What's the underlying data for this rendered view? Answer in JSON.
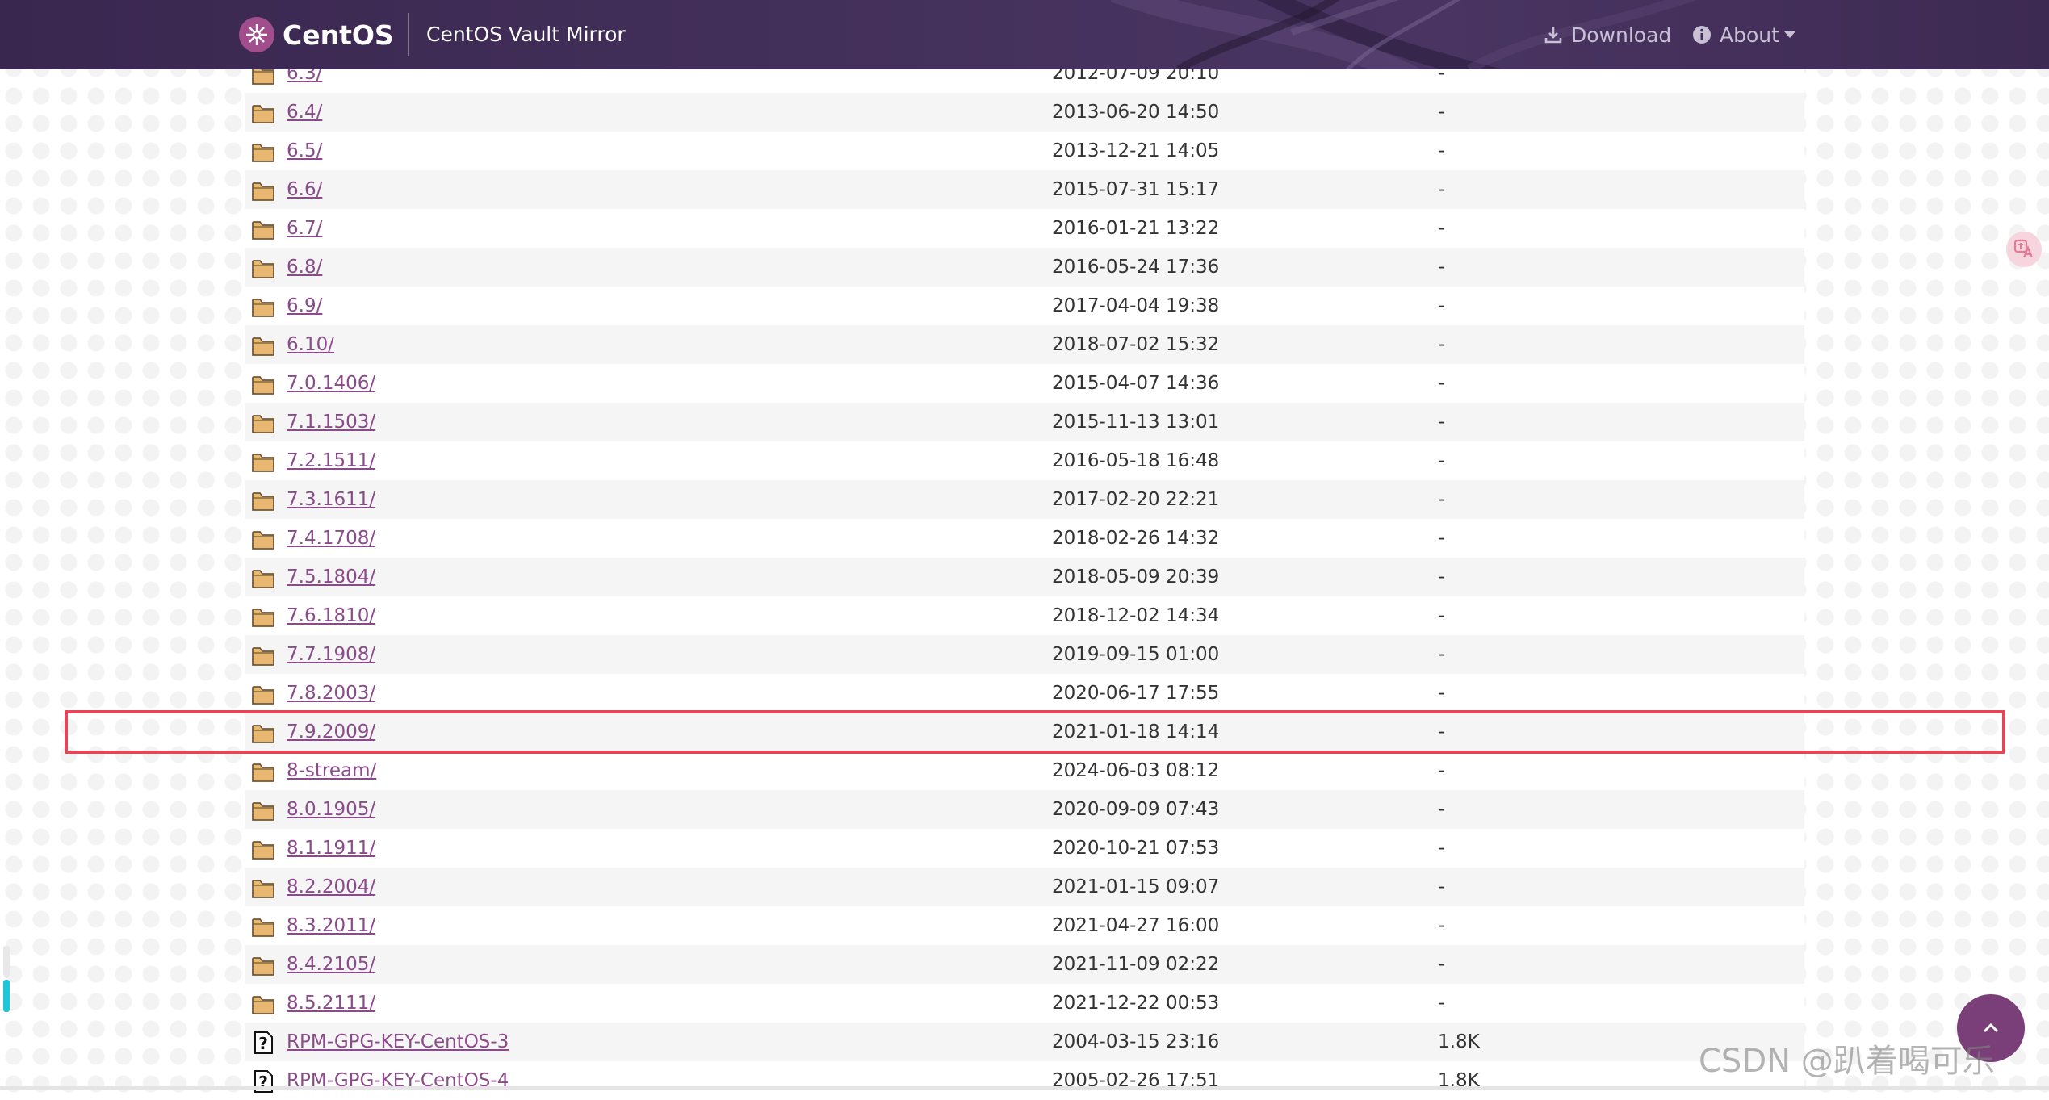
{
  "header": {
    "brand": "CentOS",
    "subtitle": "CentOS Vault Mirror",
    "nav": {
      "download": "Download",
      "about": "About"
    }
  },
  "listing": {
    "rows": [
      {
        "name": "6.3/",
        "date": "2012-07-09 20:10",
        "size": "-",
        "type": "folder"
      },
      {
        "name": "6.4/",
        "date": "2013-06-20 14:50",
        "size": "-",
        "type": "folder"
      },
      {
        "name": "6.5/",
        "date": "2013-12-21 14:05",
        "size": "-",
        "type": "folder"
      },
      {
        "name": "6.6/",
        "date": "2015-07-31 15:17",
        "size": "-",
        "type": "folder"
      },
      {
        "name": "6.7/",
        "date": "2016-01-21 13:22",
        "size": "-",
        "type": "folder"
      },
      {
        "name": "6.8/",
        "date": "2016-05-24 17:36",
        "size": "-",
        "type": "folder"
      },
      {
        "name": "6.9/",
        "date": "2017-04-04 19:38",
        "size": "-",
        "type": "folder"
      },
      {
        "name": "6.10/",
        "date": "2018-07-02 15:32",
        "size": "-",
        "type": "folder"
      },
      {
        "name": "7.0.1406/",
        "date": "2015-04-07 14:36",
        "size": "-",
        "type": "folder"
      },
      {
        "name": "7.1.1503/",
        "date": "2015-11-13 13:01",
        "size": "-",
        "type": "folder"
      },
      {
        "name": "7.2.1511/",
        "date": "2016-05-18 16:48",
        "size": "-",
        "type": "folder"
      },
      {
        "name": "7.3.1611/",
        "date": "2017-02-20 22:21",
        "size": "-",
        "type": "folder"
      },
      {
        "name": "7.4.1708/",
        "date": "2018-02-26 14:32",
        "size": "-",
        "type": "folder"
      },
      {
        "name": "7.5.1804/",
        "date": "2018-05-09 20:39",
        "size": "-",
        "type": "folder"
      },
      {
        "name": "7.6.1810/",
        "date": "2018-12-02 14:34",
        "size": "-",
        "type": "folder"
      },
      {
        "name": "7.7.1908/",
        "date": "2019-09-15 01:00",
        "size": "-",
        "type": "folder"
      },
      {
        "name": "7.8.2003/",
        "date": "2020-06-17 17:55",
        "size": "-",
        "type": "folder"
      },
      {
        "name": "7.9.2009/",
        "date": "2021-01-18 14:14",
        "size": "-",
        "type": "folder"
      },
      {
        "name": "8-stream/",
        "date": "2024-06-03 08:12",
        "size": "-",
        "type": "folder"
      },
      {
        "name": "8.0.1905/",
        "date": "2020-09-09 07:43",
        "size": "-",
        "type": "folder"
      },
      {
        "name": "8.1.1911/",
        "date": "2020-10-21 07:53",
        "size": "-",
        "type": "folder"
      },
      {
        "name": "8.2.2004/",
        "date": "2021-01-15 09:07",
        "size": "-",
        "type": "folder"
      },
      {
        "name": "8.3.2011/",
        "date": "2021-04-27 16:00",
        "size": "-",
        "type": "folder"
      },
      {
        "name": "8.4.2105/",
        "date": "2021-11-09 02:22",
        "size": "-",
        "type": "folder"
      },
      {
        "name": "8.5.2111/",
        "date": "2021-12-22 00:53",
        "size": "-",
        "type": "folder"
      },
      {
        "name": "RPM-GPG-KEY-CentOS-3",
        "date": "2004-03-15 23:16",
        "size": "1.8K",
        "type": "file"
      },
      {
        "name": "RPM-GPG-KEY-CentOS-4",
        "date": "2005-02-26 17:51",
        "size": "1.8K",
        "type": "file"
      }
    ]
  },
  "highlighted_row": "7.9.2009/",
  "watermark": "CSDN @趴着喝可乐",
  "colors": {
    "accent": "#8b4b8a",
    "navbar": "#43305a",
    "highlight": "#e0485a",
    "folder": "#e8b873"
  }
}
